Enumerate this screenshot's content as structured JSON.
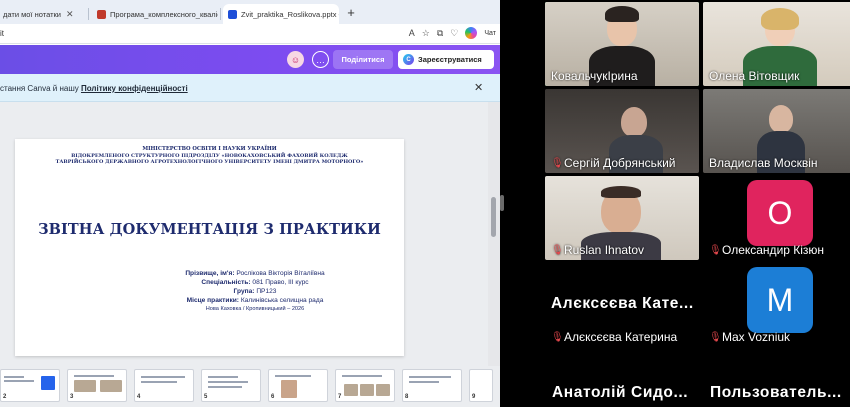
{
  "browser": {
    "tabs": [
      {
        "label": "дати мої нотатки",
        "icon_color": "#4a4a4a",
        "active": false
      },
      {
        "label": "Програма_комплексного_кваліф",
        "icon_color": "#c0392b",
        "active": false
      },
      {
        "label": "Zvit_praktika_Roslikova.pptx - Пре",
        "icon_color": "#1d4ed8",
        "active": true
      }
    ],
    "new_tab_symbol": "+",
    "close_symbol": "✕",
    "address_text": "it",
    "address_icons": [
      "A",
      "☆",
      "⧉",
      "♡"
    ],
    "chat_label": "Чат",
    "canva": {
      "share_label": "Поділитися",
      "register_label": "Зареєструватися",
      "logo_text": "C"
    },
    "notice": {
      "prefix": "стання Canva й нашу ",
      "link": "Політику конфіденційності",
      "close_symbol": "✕"
    },
    "slide": {
      "ministry": "МІНІСТЕРСТВО ОСВІТИ І НАУКИ УКРАЇНИ",
      "institution": "ВІДОКРЕМЛЕНОГО СТРУКТУРНОГО ПІДРОЗДІЛУ «НОВОКАХОВСЬКИЙ ФАХОВИЙ КОЛЕДЖ ТАВРІЙСЬКОГО ДЕРЖАВНОГО АГРОТЕХНОЛОГІЧНОГО УНІВЕРСИТЕТУ ІМЕНІ ДМИТРА МОТОРНОГО»",
      "title": "ЗВІТНА ДОКУМЕНТАЦІЯ З ПРАКТИКИ",
      "rows": [
        {
          "label": "Прізвище, ім'я:",
          "value": " Рослікова Вікторія Віталіївна"
        },
        {
          "label": "Спеціальність:",
          "value": " 081 Право, ІІІ курс"
        },
        {
          "label": "Група:",
          "value": " ПР123"
        },
        {
          "label": "Місце практики:",
          "value": " Калинівська селищна рада"
        }
      ],
      "footer": "Нова Каховка / Кропивницький – 2026"
    },
    "thumbnails": [
      "2",
      "3",
      "4",
      "5",
      "6",
      "7",
      "8",
      "9"
    ]
  },
  "conference": {
    "tiles": [
      {
        "name": "КовальчукІрина",
        "muted": false,
        "type": "video",
        "speaking": true
      },
      {
        "name": "Олена Вітовщик",
        "muted": false,
        "type": "video",
        "speaking": false
      },
      {
        "name": "Сергій Добрянський",
        "muted": true,
        "type": "video",
        "speaking": false
      },
      {
        "name": "Владислав Москвін",
        "muted": false,
        "type": "video",
        "speaking": false
      },
      {
        "name": "Ruslan Ihnatov",
        "muted": true,
        "type": "video",
        "speaking": false
      },
      {
        "name": "Олександир Кізюн",
        "muted": true,
        "type": "avatar",
        "initial": "О",
        "color": "#e0245e",
        "speaking": false
      },
      {
        "name": "Алєксєєва Катерина",
        "muted": true,
        "type": "name",
        "display": "Алєксєєва Кате...",
        "speaking": false
      },
      {
        "name": "Max Vozniuk",
        "muted": true,
        "type": "avatar",
        "initial": "M",
        "color": "#1c7ed6",
        "speaking": false
      }
    ],
    "bottom_names": [
      "Анатолій Сидо...",
      "Пользователь..."
    ],
    "speaking_color": "#4ade80",
    "muted_color": "#e5484d"
  }
}
